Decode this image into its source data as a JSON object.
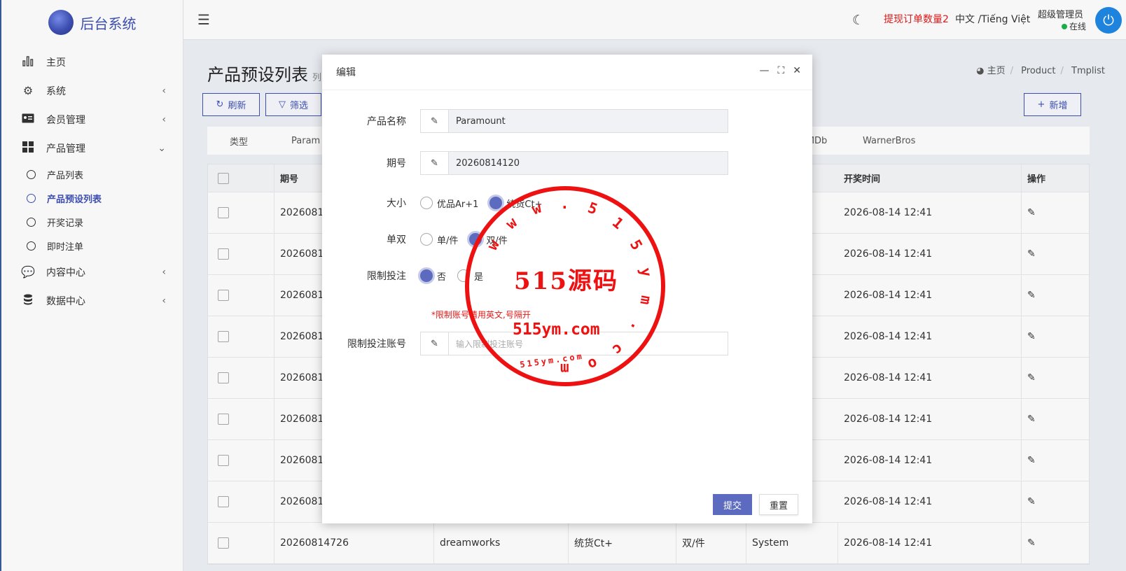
{
  "app": {
    "title": "后台系统"
  },
  "sidebar": {
    "items": [
      {
        "label": "主页",
        "icon": "bar-chart-icon"
      },
      {
        "label": "系统",
        "icon": "gear-icon"
      },
      {
        "label": "会员管理",
        "icon": "id-card-icon"
      },
      {
        "label": "产品管理",
        "icon": "grid-icon"
      },
      {
        "label": "内容中心",
        "icon": "chat-icon"
      },
      {
        "label": "数据中心",
        "icon": "database-icon"
      }
    ],
    "subitems": [
      {
        "label": "产品列表"
      },
      {
        "label": "产品预设列表"
      },
      {
        "label": "开奖记录"
      },
      {
        "label": "即时注单"
      }
    ]
  },
  "topbar": {
    "alert": "提现订单数量2",
    "lang": "中文 /Tiếng Việt",
    "user_name": "超级管理员",
    "user_status": "在线"
  },
  "page": {
    "title": "产品预设列表",
    "subtitle": "列",
    "breadcrumb": [
      "主页",
      "Product",
      "Tmplist"
    ],
    "refresh": "刷新",
    "filter": "筛选",
    "add": "新增"
  },
  "typebar": {
    "label": "类型",
    "first": "Param",
    "imdb": "IMDb",
    "wb": "WarnerBros"
  },
  "table": {
    "headers": {
      "period": "期号",
      "draw_time": "开奖时间",
      "action": "操作"
    },
    "rows": [
      {
        "period": "2026081",
        "time": "2026-08-14 12:41"
      },
      {
        "period": "2026081",
        "time": "2026-08-14 12:41"
      },
      {
        "period": "2026081",
        "time": "2026-08-14 12:41"
      },
      {
        "period": "2026081",
        "time": "2026-08-14 12:41"
      },
      {
        "period": "2026081",
        "time": "2026-08-14 12:41"
      },
      {
        "period": "2026081",
        "time": "2026-08-14 12:41"
      },
      {
        "period": "2026081",
        "time": "2026-08-14 12:41"
      },
      {
        "period": "2026081",
        "time": "2026-08-14 12:41"
      }
    ],
    "last_row": {
      "period": "20260814726",
      "product": "dreamworks",
      "size": "统货Ct+",
      "pair": "双/件",
      "source": "System",
      "time": "2026-08-14 12:41"
    }
  },
  "modal": {
    "title": "编辑",
    "product_label": "产品名称",
    "product_value": "Paramount",
    "period_label": "期号",
    "period_value": "20260814120",
    "size_label": "大小",
    "size_opt1": "优品Ar+1",
    "size_opt2": "统货Ct+",
    "pair_label": "单双",
    "pair_opt1": "单/件",
    "pair_opt2": "双/件",
    "limit_label": "限制投注",
    "limit_opt1": "否",
    "limit_opt2": "是",
    "hint": "*限制账号请用英文,号隔开",
    "account_label": "限制投注账号",
    "account_placeholder": "输入限制投注账号",
    "submit": "提交",
    "reset": "重置"
  },
  "watermark": {
    "main": "515源码",
    "url": "515ym.com",
    "small": "515ym.com",
    "arc": "www.515ym.com"
  }
}
